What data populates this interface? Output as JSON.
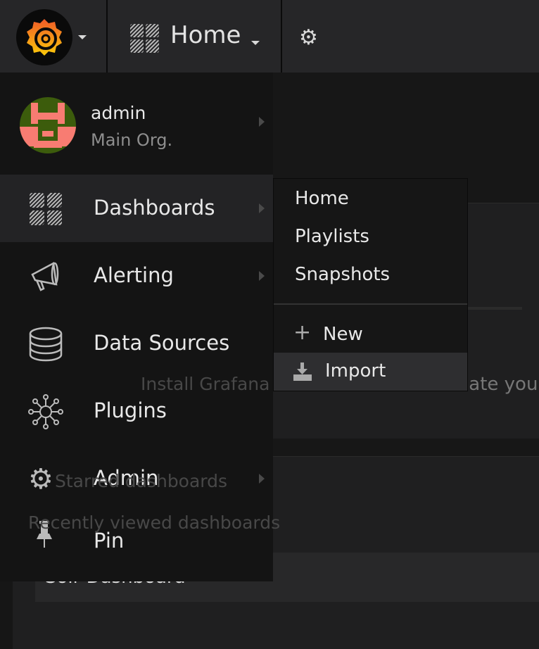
{
  "navbar": {
    "title": "Home",
    "logo": "grafana-logo",
    "dashboards_icon": "dashboards-icon",
    "settings_icon": "gear-icon"
  },
  "background": {
    "install": "Install Grafana",
    "create": "Create your",
    "starred": "Starred dashboards",
    "recent": "Recently viewed dashboards",
    "recent_item": "Solr Dashboard"
  },
  "profile": {
    "name": "admin",
    "org": "Main Org."
  },
  "menu": {
    "items": [
      {
        "label": "Dashboards",
        "icon": "dashboards-icon",
        "submenu": true,
        "active": true
      },
      {
        "label": "Alerting",
        "icon": "megaphone-icon",
        "submenu": true
      },
      {
        "label": "Data Sources",
        "icon": "database-icon",
        "submenu": false
      },
      {
        "label": "Plugins",
        "icon": "plugins-icon",
        "submenu": false
      },
      {
        "label": "Admin",
        "icon": "gears-icon",
        "submenu": true
      },
      {
        "label": "Pin",
        "icon": "pin-icon",
        "submenu": false
      }
    ]
  },
  "submenu": {
    "items": [
      "Home",
      "Playlists",
      "Snapshots"
    ],
    "new": "New",
    "import": "Import"
  },
  "colors": {
    "navbar": "#262628",
    "menu": "#141414",
    "active": "#232325",
    "accent": "#f46800"
  }
}
